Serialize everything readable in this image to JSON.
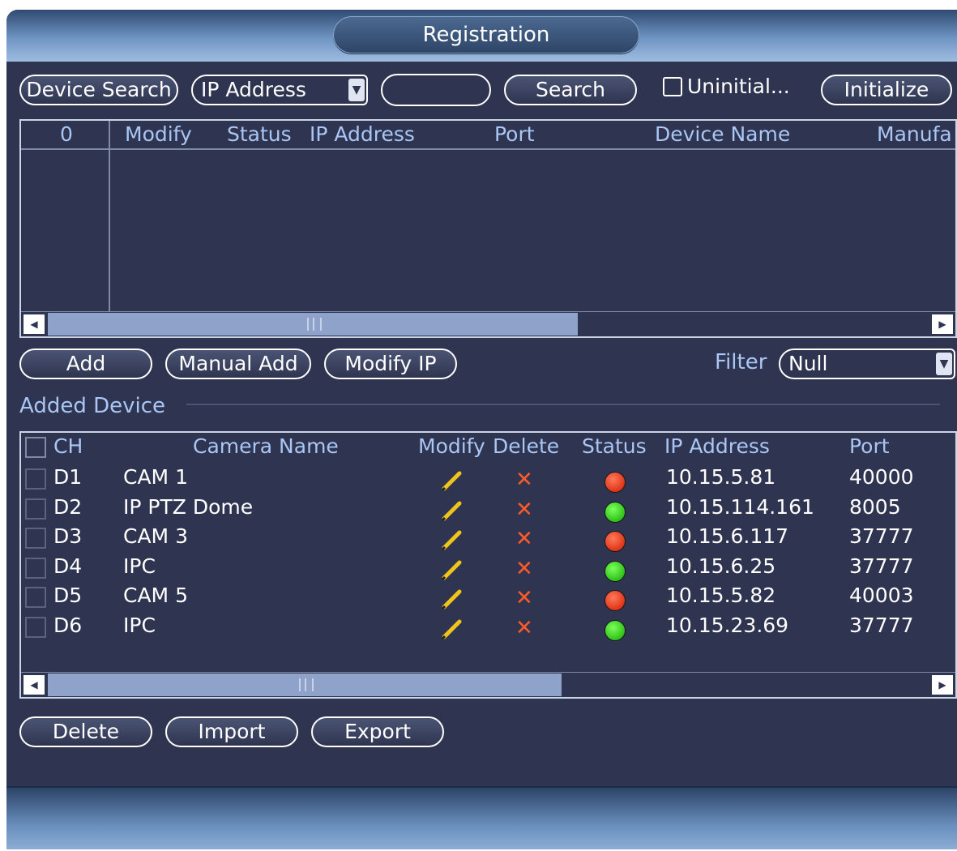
{
  "window": {
    "title": "Registration"
  },
  "toolbar": {
    "device_search_label": "Device Search",
    "ip_filter_selected": "IP Address",
    "search_value": "",
    "search_label": "Search",
    "uninitialized_label": "Uninitial...",
    "initialize_label": "Initialize"
  },
  "search_results": {
    "columns": [
      "0",
      "Modify",
      "Status",
      "IP Address",
      "Port",
      "Device Name",
      "Manufa"
    ],
    "rows": []
  },
  "actions": {
    "add_label": "Add",
    "manual_add_label": "Manual Add",
    "modify_ip_label": "Modify IP",
    "filter_label": "Filter",
    "filter_selected": "Null"
  },
  "added_device": {
    "section_title": "Added Device",
    "columns": [
      "CH",
      "Camera Name",
      "Modify",
      "Delete",
      "Status",
      "IP Address",
      "Port"
    ],
    "rows": [
      {
        "ch": "D1",
        "name": "CAM 1",
        "status": "offline",
        "ip": "10.15.5.81",
        "port": "40000"
      },
      {
        "ch": "D2",
        "name": "IP PTZ Dome",
        "status": "online",
        "ip": "10.15.114.161",
        "port": "8005"
      },
      {
        "ch": "D3",
        "name": "CAM 3",
        "status": "offline",
        "ip": "10.15.6.117",
        "port": "37777"
      },
      {
        "ch": "D4",
        "name": "IPC",
        "status": "online",
        "ip": "10.15.6.25",
        "port": "37777"
      },
      {
        "ch": "D5",
        "name": "CAM 5",
        "status": "offline",
        "ip": "10.15.5.82",
        "port": "40003"
      },
      {
        "ch": "D6",
        "name": "IPC",
        "status": "online",
        "ip": "10.15.23.69",
        "port": "37777"
      }
    ]
  },
  "bottom_actions": {
    "delete_label": "Delete",
    "import_label": "Import",
    "export_label": "Export"
  },
  "colors": {
    "background": "#2f3550",
    "header_text": "#a9c6f5",
    "online": "#2fc21a",
    "offline": "#e03418",
    "delete_mark": "#ff5a2a",
    "modify_pencil": "#f0c419"
  }
}
